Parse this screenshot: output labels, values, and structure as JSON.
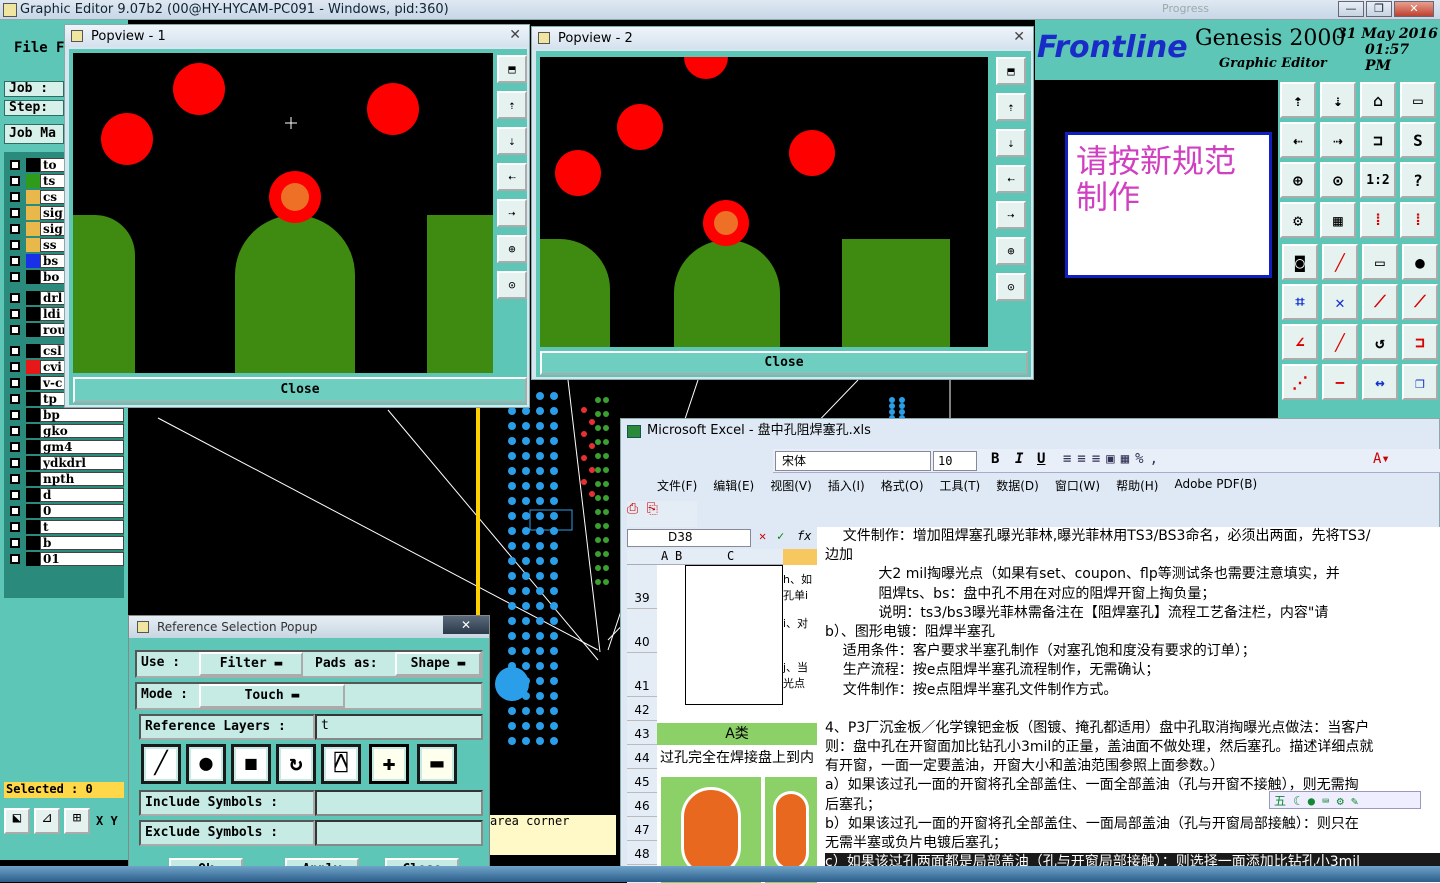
{
  "window": {
    "title": "Graphic Editor 9.07b2 (00@HY-HYCAM-PC091 - Windows, pid:360)",
    "bg_title": "Progress",
    "min": "—",
    "max": "❐",
    "close": "✕"
  },
  "menu": {
    "file": "File",
    "f2": "F"
  },
  "left": {
    "job_label": "Job :",
    "step_label": "Step:",
    "job_manager": "Job Ma",
    "layers": [
      {
        "name": "to",
        "color": "#000000"
      },
      {
        "name": "ts",
        "color": "#2e9c1a"
      },
      {
        "name": "cs",
        "color": "#e8b84a"
      },
      {
        "name": "sig",
        "color": "#e8b84a"
      },
      {
        "name": "sig",
        "color": "#e8b84a"
      },
      {
        "name": "ss",
        "color": "#e8b84a"
      },
      {
        "name": "bs",
        "color": "#1830e8"
      },
      {
        "name": "bo",
        "color": "#000000"
      },
      {
        "name": "drl",
        "color": "#000000"
      },
      {
        "name": "ldi",
        "color": "#000000"
      },
      {
        "name": "rou",
        "color": "#000000"
      },
      {
        "name": "csl",
        "color": "#000000"
      },
      {
        "name": "cvi",
        "color": "#e81818"
      },
      {
        "name": "v-c",
        "color": "#000000"
      },
      {
        "name": "tp",
        "color": "#000000"
      },
      {
        "name": "bp",
        "color": "#000000"
      },
      {
        "name": "gko",
        "color": "#000000"
      },
      {
        "name": "gm4",
        "color": "#000000"
      },
      {
        "name": "ydkdrl",
        "color": "#000000"
      },
      {
        "name": "npth",
        "color": "#000000"
      },
      {
        "name": "d",
        "color": "#000000"
      },
      {
        "name": "0",
        "color": "#000000"
      },
      {
        "name": "t",
        "color": "#000000"
      },
      {
        "name": "b",
        "color": "#000000"
      },
      {
        "name": "01",
        "color": "#000000"
      }
    ],
    "selected": "Selected : 0",
    "xy": "X Y"
  },
  "brand": {
    "logo": "Frontline",
    "product": "Genesis 2000",
    "subtitle": "Graphic Editor",
    "date": "31 May 2016",
    "time": "01:57 PM"
  },
  "notice": "请按新规范制作",
  "popview1": {
    "title": "Popview - 1",
    "close": "Close"
  },
  "popview2": {
    "title": "Popview - 2",
    "close": "Close"
  },
  "status_hint": "area corner",
  "refpopup": {
    "title": "Reference Selection Popup",
    "close": "✕",
    "use_label": "Use  :",
    "use_value": "Filter",
    "pads_label": "Pads as:",
    "pads_value": "Shape",
    "mode_label": "Mode  :",
    "mode_value": "Touch",
    "ref_layers_label": "Reference Layers :",
    "ref_layers_value": "t",
    "include_label": "Include Symbols :",
    "exclude_label": "Exclude Symbols :",
    "ok": "Ok",
    "apply": "Apply",
    "close_btn": "Close"
  },
  "excel": {
    "title": "Microsoft Excel - 盘中孔阻焊塞孔.xls",
    "font_name": "宋体",
    "font_size": "10",
    "menus": [
      "文件(F)",
      "编辑(E)",
      "视图(V)",
      "插入(I)",
      "格式(O)",
      "工具(T)",
      "数据(D)",
      "窗口(W)",
      "帮助(H)",
      "Adobe PDF(B)"
    ],
    "cell_ref": "D38",
    "cols": [
      "A",
      "B",
      "C"
    ],
    "rows": [
      "39",
      "40",
      "41",
      "42",
      "43",
      "44",
      "45",
      "46",
      "47",
      "48"
    ],
    "cell_texts": [
      "h、如孔单i",
      "i、对",
      "j、当光点"
    ],
    "category": "A类",
    "caption": "过孔完全在焊接盘上到内",
    "lines": [
      "    文件制作：增加阻焊塞孔曝光菲林,曝光菲林用TS3/BS3命名，必须出两面，先将TS3/",
      "边加",
      "            大2 mil掏曝光点（如果有set、coupon、flp等测试条也需要注意填实，并",
      "            阻焊ts、bs：盘中孔不用在对应的阻焊开窗上掏负量；",
      "            说明：ts3/bs3曝光菲林需备注在【阻焊塞孔】流程工艺备注栏，内容\"请",
      "b）、图形电镀：阻焊半塞孔",
      "    适用条件：客户要求半塞孔制作（对塞孔饱和度没有要求的订单）；",
      "    生产流程：按e点阻焊半塞孔流程制作，无需确认；",
      "    文件制作：按e点阻焊半塞孔文件制作方式。",
      "",
      "4、P3厂沉金板／化学镍钯金板（图镀、掩孔都适用）盘中孔取消掏曝光点做法：当客户",
      "则：盘中孔在开窗面加比钻孔小3mil的正量，盖油面不做处理，然后塞孔。描述详细点就",
      "有开窗，一面一定要盖油，开窗大小和盖油范围参照上面参数。）",
      "a）如果该过孔一面的开窗将孔全部盖住、一面全部盖油（孔与开窗不接触），则无需掏",
      "后塞孔；",
      "b）如果该过孔一面的开窗将孔全部盖住、一面局部盖油（孔与开窗局部接触）：则只在",
      "无需半塞或负片电镀后塞孔；",
      "c）如果该过孔两面都是局部盖油（孔与开窗局部接触）：则选择一面添加比钻孔小3mil"
    ],
    "ime": "五"
  },
  "colors": {
    "teal": "#5ec6b6",
    "green": "#3a8a10",
    "red": "#ff0000",
    "via": "#2a9ee8"
  }
}
